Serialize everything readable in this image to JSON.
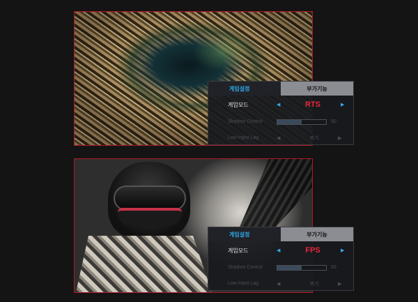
{
  "panels": [
    {
      "id": "rts",
      "osd": {
        "tabs": [
          "게임설정",
          "부가기능"
        ],
        "game_mode_label": "게임모드",
        "game_mode_value": "RTS",
        "shadow_control_label": "Shadow Control",
        "shadow_control_value": "50",
        "shadow_control_level": 0.5,
        "low_input_lag_label": "Low Input Lag",
        "low_input_lag_value": "꺼기"
      }
    },
    {
      "id": "fps",
      "osd": {
        "tabs": [
          "게임설정",
          "부가기능"
        ],
        "game_mode_label": "게임모드",
        "game_mode_value": "FPS",
        "shadow_control_label": "Shadow Control",
        "shadow_control_value": "50",
        "shadow_control_level": 0.5,
        "low_input_lag_label": "Low Input Lag",
        "low_input_lag_value": "꺼기"
      }
    }
  ],
  "icons": {
    "left_arrow": "left-triangle-icon",
    "right_arrow": "right-triangle-icon"
  },
  "colors": {
    "panel_border": "#b0182a",
    "active_tab_text": "#2ea7e6",
    "mode_value": "#e8283a",
    "arrow_active": "#35a8e8"
  }
}
